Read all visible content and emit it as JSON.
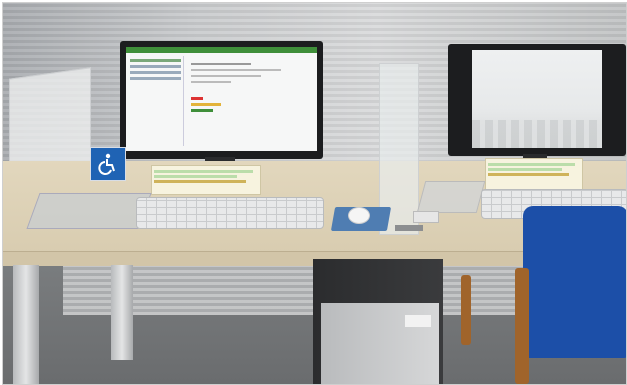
{
  "scene": {
    "description_visible_text": [],
    "colors": {
      "desk": "#dcd0b4",
      "mousepad": "#4f7db2",
      "chair": "#1c4fa8",
      "accessibility_sign": "#1f63b4",
      "monitor_frame": "#1c1d1f"
    },
    "icons": [
      "wheelchair-icon"
    ]
  }
}
